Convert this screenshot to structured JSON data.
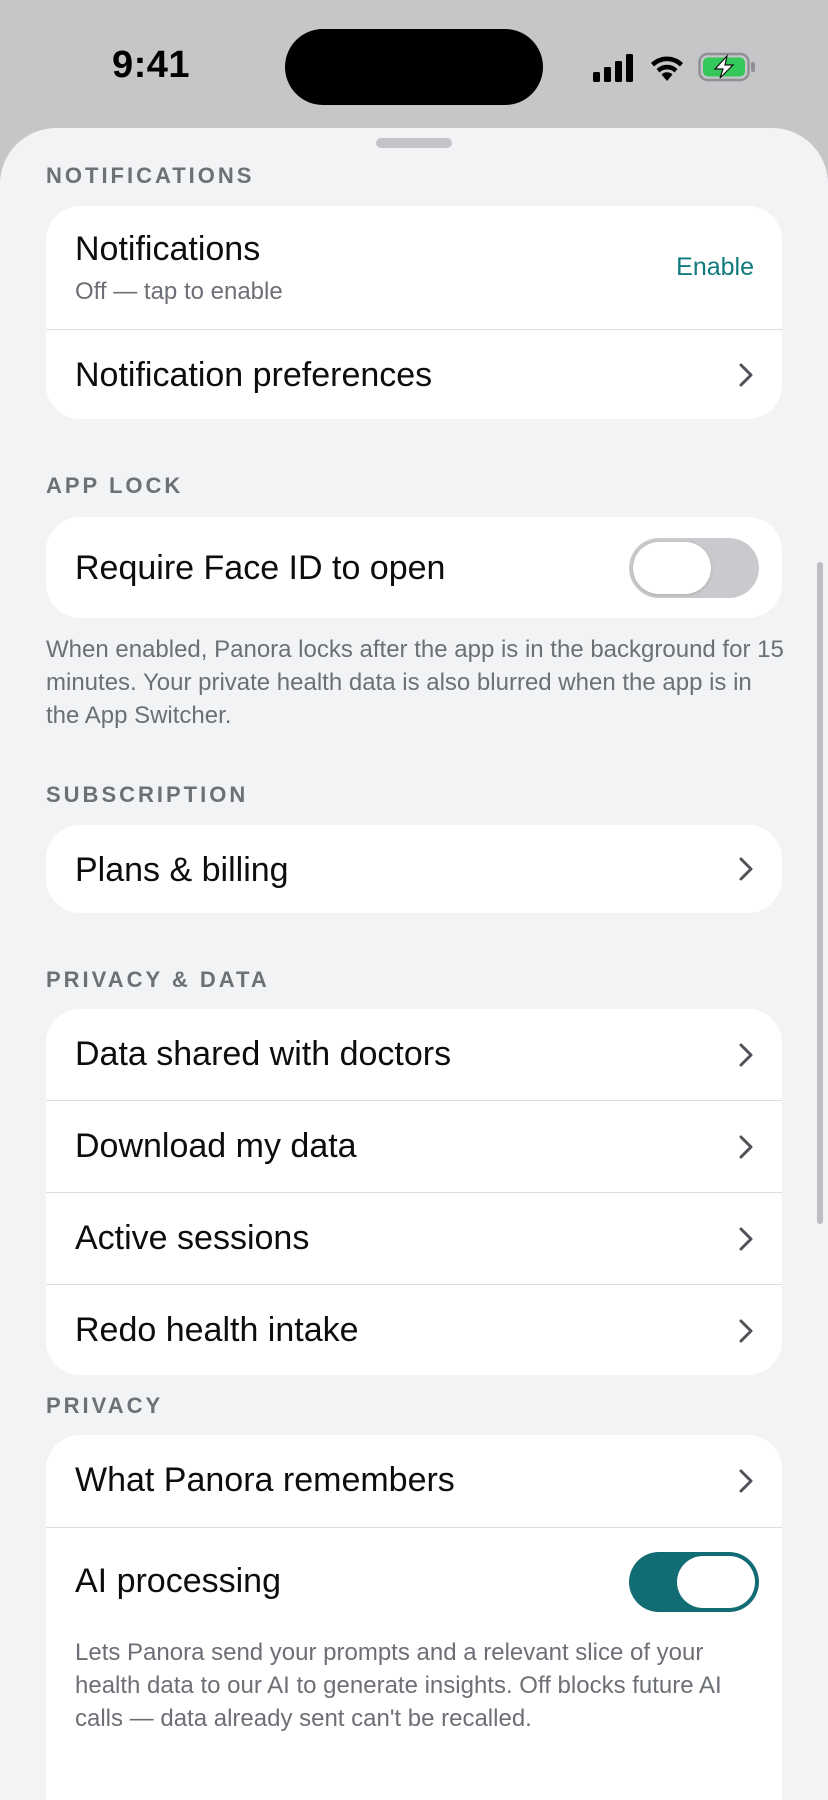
{
  "status_bar": {
    "time": "9:41"
  },
  "sections": {
    "notifications": {
      "label": "NOTIFICATIONS",
      "main_title": "Notifications",
      "main_subtitle": "Off — tap to enable",
      "enable_label": "Enable",
      "preferences_label": "Notification preferences"
    },
    "app_lock": {
      "label": "APP LOCK",
      "face_id_label": "Require Face ID to open",
      "face_id_enabled": false,
      "footnote": "When enabled, Panora locks after the app is in the background for 15 minutes. Your private health data is also blurred when the app is in the App Switcher."
    },
    "subscription": {
      "label": "SUBSCRIPTION",
      "plans_label": "Plans & billing"
    },
    "privacy_data": {
      "label": "PRIVACY & DATA",
      "items": [
        "Data shared with doctors",
        "Download my data",
        "Active sessions",
        "Redo health intake"
      ]
    },
    "privacy": {
      "label": "PRIVACY",
      "remembers_label": "What Panora remembers",
      "ai_label": "AI processing",
      "ai_enabled": true,
      "ai_note": "Lets Panora send your prompts and a relevant slice of your health data to our AI to generate insights. Off blocks future AI calls — data already sent can't be recalled."
    }
  },
  "colors": {
    "accent": "#127a7d",
    "toggle_on": "#116d73",
    "toggle_off": "#c9cacd",
    "battery_fill": "#34c759"
  },
  "icons": {
    "row_arrow": "chevron-right-icon"
  }
}
